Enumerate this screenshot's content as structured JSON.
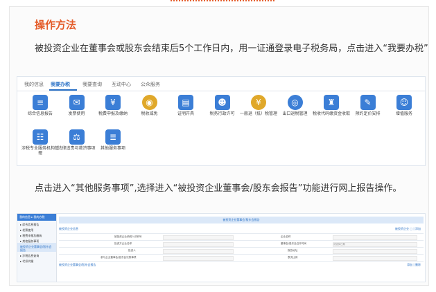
{
  "section_title": "操作方法",
  "para1": "被投资企业在董事会或股东会结束后5个工作日内，用一证通登录电子税务局，点击进入“我要办税”",
  "para2": "点击进入“其他服务事项”,选择进入“被投资企业董事会/股东会报告”功能进行网上报告操作。",
  "nav_tabs": [
    "我的信息",
    "我要办税",
    "我要查询",
    "互动中心",
    "公众服务"
  ],
  "services_row1": [
    {
      "label": "综合信息报告",
      "icon": "doc-icon",
      "color": "#3b7ed6"
    },
    {
      "label": "发票使用",
      "icon": "invoice-icon",
      "color": "#3b7ed6"
    },
    {
      "label": "税费申报及缴纳",
      "icon": "yen-icon",
      "color": "#3b7ed6"
    },
    {
      "label": "税收减免",
      "icon": "coin-icon",
      "color": "#e0a82a"
    },
    {
      "label": "证明开具",
      "icon": "certificate-icon",
      "color": "#3b7ed6"
    },
    {
      "label": "税务行政许可",
      "icon": "person-icon",
      "color": "#3b7ed6"
    },
    {
      "label": "一般退（抵）税管理",
      "icon": "refund-icon",
      "color": "#e0a82a"
    },
    {
      "label": "出口退税管理",
      "icon": "globe-icon",
      "color": "#3b7ed6"
    },
    {
      "label": "税收代码缴资金收取",
      "icon": "bag-icon",
      "color": "#3b7ed6"
    },
    {
      "label": "预约定价安排",
      "icon": "compass-icon",
      "color": "#3b7ed6"
    },
    {
      "label": "增值服务",
      "icon": "user-icon",
      "color": "#3b7ed6"
    }
  ],
  "services_row2": [
    {
      "label": "涉税专业服务机构管理",
      "icon": "org-icon",
      "color": "#3b7ed6"
    },
    {
      "label": "法律追责与救济事项",
      "icon": "law-icon",
      "color": "#3b7ed6"
    },
    {
      "label": "其他服务事项",
      "icon": "list-icon",
      "color": "#3b7ed6"
    }
  ],
  "shot2": {
    "side_head": "我的信息   ▸ 我的办税",
    "side_items": [
      "▸ 综合信息报告",
      "▸ 发票使用",
      "▸ 税费申报及缴纳",
      "▸ 其他服务事项",
      "被投资企业董事会/股东会报告",
      "▸ 涉税信息查询",
      "▸ 代扣代缴"
    ],
    "form_title": "被投资企业董事会/股东会报告",
    "sub_left": "被投资企业信息",
    "sub_right": "被投资企业   □ | 添加",
    "rows": [
      [
        "被投资企业纳税人识别号",
        "企业名称"
      ],
      [
        "投资方企业名称",
        "董事会/股东会召开时间"
      ],
      [
        "投资人",
        "报告地址"
      ],
      [
        "参与企业董事会/股东会决策事项",
        "表决比例"
      ]
    ],
    "date_placeholder": "请选择日期",
    "foot_left": "被投资企业董事会/股东会报告",
    "foot_right": "添加 | 删除"
  }
}
